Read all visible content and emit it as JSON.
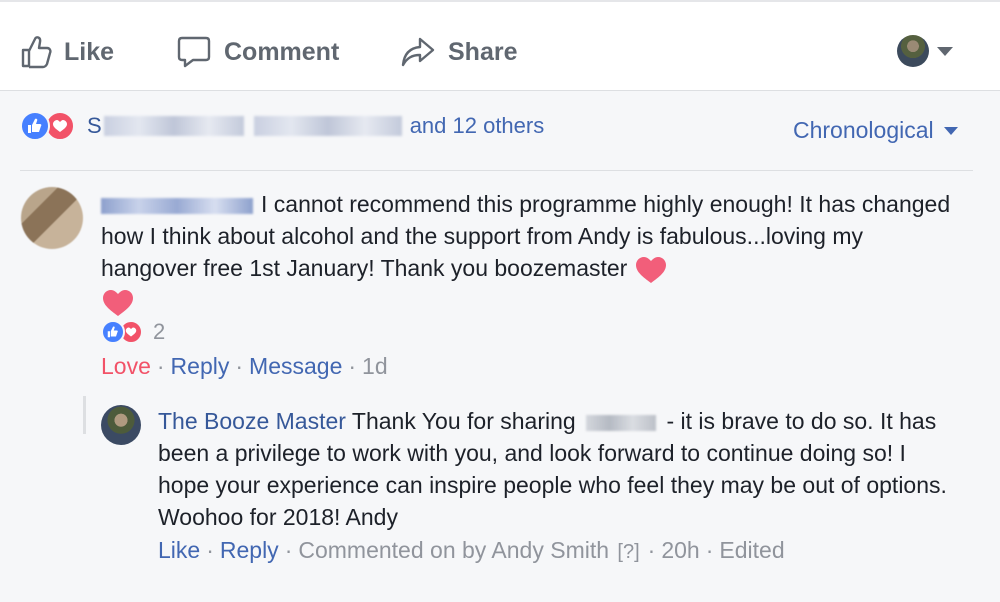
{
  "actions": {
    "like_label": "Like",
    "comment_label": "Comment",
    "share_label": "Share"
  },
  "reactions_summary": {
    "name_initial": "S",
    "others_text": "and 12 others"
  },
  "sort": {
    "label": "Chronological"
  },
  "comment": {
    "text": "I cannot recommend this programme highly enough! It has changed how I think about alcohol and the support from Andy is fabulous...loving my hangover free 1st January! Thank you boozemaster",
    "reaction_count": "2",
    "actions": {
      "love": "Love",
      "reply": "Reply",
      "message": "Message",
      "time": "1d"
    }
  },
  "reply": {
    "author": "The Booze Master",
    "text_before": "Thank You for sharing",
    "text_after": "- it is brave to do so. It has been a privilege to work with you, and look forward to continue doing so! I hope your experience can inspire people who feel they may be out of options. Woohoo for 2018! Andy",
    "actions": {
      "like": "Like",
      "reply": "Reply",
      "commented_on": "Commented on by Andy Smith",
      "help": "[?]",
      "time": "20h",
      "edited": "Edited"
    }
  },
  "colors": {
    "link_blue": "#4267b2",
    "love_red": "#f25268",
    "muted_gray": "#90949c",
    "comments_bg": "#f6f7f9"
  }
}
